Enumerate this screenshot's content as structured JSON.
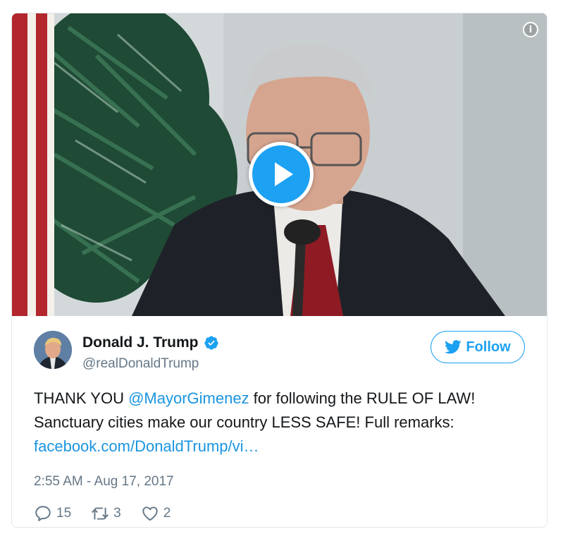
{
  "media": {
    "type": "video",
    "info_icon": "info-icon",
    "play_icon": "play-icon"
  },
  "author": {
    "name": "Donald J. Trump",
    "handle": "@realDonaldTrump",
    "verified": true,
    "avatar": "avatar-image"
  },
  "follow_button": {
    "label": "Follow",
    "icon": "twitter-bird-icon"
  },
  "tweet": {
    "text_before_mention": "THANK YOU ",
    "mention": "@MayorGimenez",
    "text_after_mention": " for following the RULE OF LAW! Sanctuary cities make our country LESS SAFE! Full remarks: ",
    "link": "facebook.com/DonaldTrump/vi…",
    "timestamp": "2:55 AM - Aug 17, 2017"
  },
  "actions": {
    "reply_count": "15",
    "retweet_count": "3",
    "like_count": "2"
  },
  "colors": {
    "accent": "#1da1f2",
    "link": "#1b95e0",
    "secondary_text": "#657786",
    "border": "#e1e8ed"
  }
}
